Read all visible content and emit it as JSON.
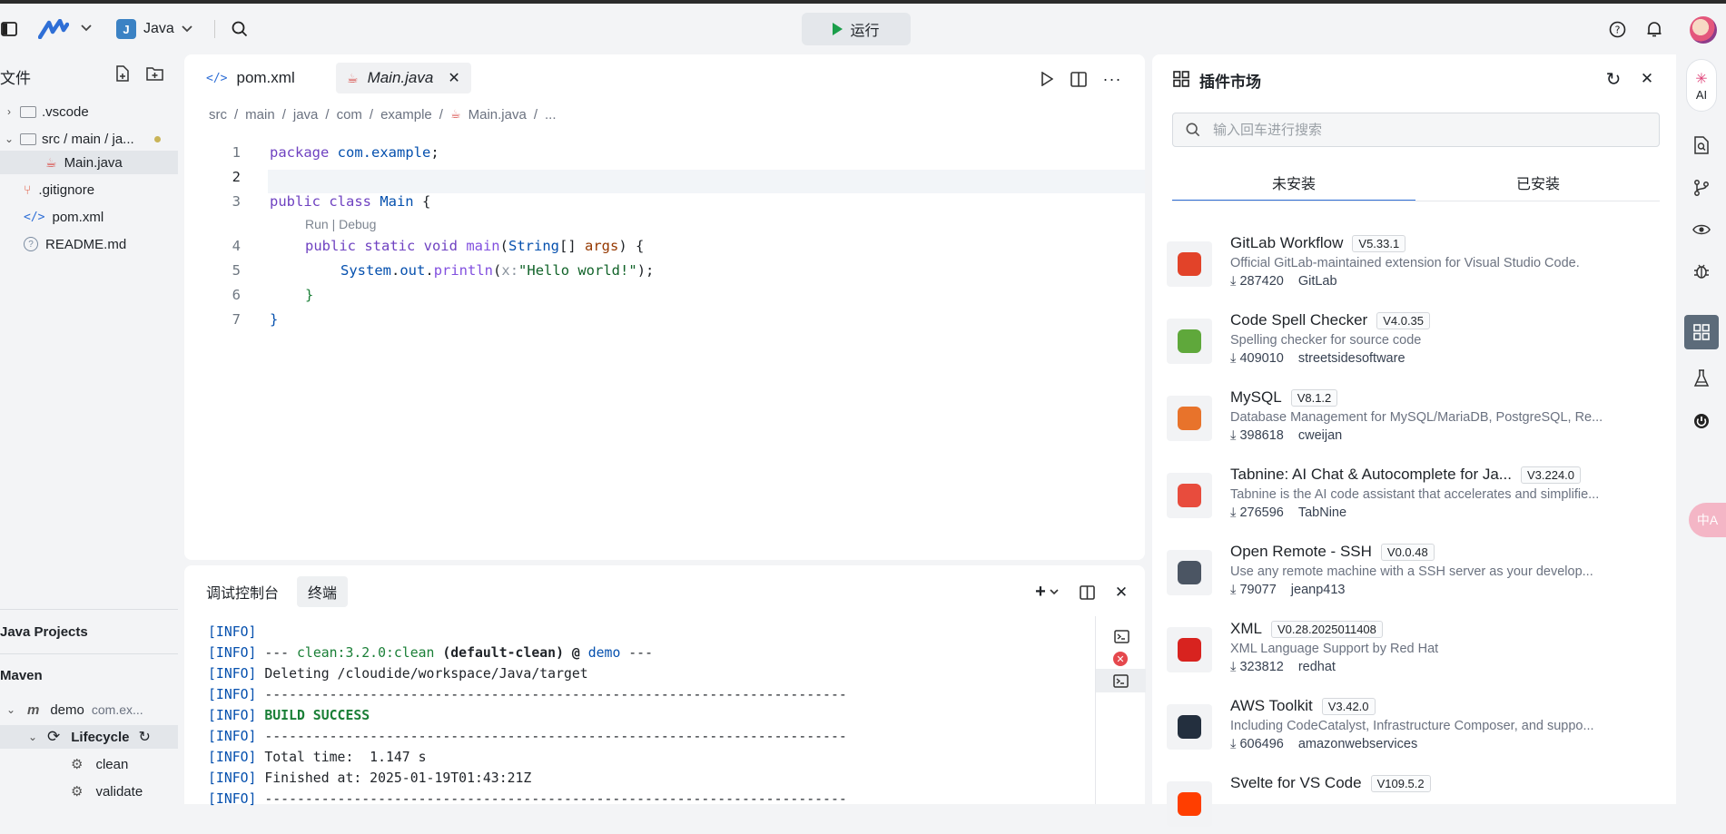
{
  "topbar": {
    "project_name": "Java",
    "run_label": "运行"
  },
  "sidebar": {
    "title": "文件",
    "tree": [
      {
        "label": ".vscode"
      },
      {
        "label": "src / main / ja..."
      },
      {
        "label": "Main.java"
      },
      {
        "label": ".gitignore"
      },
      {
        "label": "pom.xml"
      },
      {
        "label": "README.md"
      }
    ],
    "java_projects": "Java Projects",
    "maven": "Maven",
    "maven_tree": [
      {
        "label": "demo",
        "sub": "com.ex..."
      },
      {
        "label": "Lifecycle"
      },
      {
        "label": "clean"
      },
      {
        "label": "validate"
      }
    ]
  },
  "editor": {
    "tabs": [
      {
        "label": "pom.xml"
      },
      {
        "label": "Main.java"
      }
    ],
    "breadcrumb": [
      "src",
      "main",
      "java",
      "com",
      "example",
      "Main.java",
      "..."
    ],
    "line_numbers": [
      "1",
      "2",
      "3",
      "4",
      "5",
      "6",
      "7"
    ],
    "codelens": "Run | Debug",
    "code": {
      "l1_kw": "package",
      "l1_pkg": " com.example",
      "l1_end": ";",
      "l3_kw": "public class",
      "l3_name": " Main",
      "l3_end": " {",
      "l4_kw": "public static void",
      "l4_fn": " main",
      "l4_p1": "(",
      "l4_type": "String",
      "l4_p2": "[] ",
      "l4_arg": "args",
      "l4_end": ") {",
      "l5_obj": "System",
      "l5_dot1": ".",
      "l5_out": "out",
      "l5_dot2": ".",
      "l5_fn": "println",
      "l5_p1": "(",
      "l5_hint": "x:",
      "l5_str": "\"Hello world!\"",
      "l5_end": ");",
      "l6": "}",
      "l7": "}"
    }
  },
  "terminal": {
    "tabs": [
      {
        "label": "调试控制台"
      },
      {
        "label": "终端"
      }
    ],
    "lines": [
      {
        "tag": "[INFO]",
        "text": ""
      },
      {
        "tag": "[INFO]",
        "pre": " --- ",
        "clean": "clean:3.2.0:clean",
        "mid": " (default-clean) @ ",
        "demo": "demo",
        "post": " ---"
      },
      {
        "tag": "[INFO]",
        "text": " Deleting /cloudide/workspace/Java/target"
      },
      {
        "tag": "[INFO]",
        "text": " ------------------------------------------------------------------------"
      },
      {
        "tag": "[INFO]",
        "success": " BUILD SUCCESS"
      },
      {
        "tag": "[INFO]",
        "text": " ------------------------------------------------------------------------"
      },
      {
        "tag": "[INFO]",
        "text": " Total time:  1.147 s"
      },
      {
        "tag": "[INFO]",
        "text": " Finished at: 2025-01-19T01:43:21Z"
      },
      {
        "tag": "[INFO]",
        "text": " ------------------------------------------------------------------------"
      }
    ]
  },
  "market": {
    "title": "插件市场",
    "search_placeholder": "输入回车进行搜索",
    "tabs": [
      {
        "label": "未安装"
      },
      {
        "label": "已安装"
      }
    ],
    "extensions": [
      {
        "name": "GitLab Workflow",
        "version": "V5.33.1",
        "desc": "Official GitLab-maintained extension for Visual Studio Code.",
        "downloads": "287420",
        "publisher": "GitLab",
        "color": "#e24329"
      },
      {
        "name": "Code Spell Checker",
        "version": "V4.0.35",
        "desc": "Spelling checker for source code",
        "downloads": "409010",
        "publisher": "streetsidesoftware",
        "color": "#5fa83b"
      },
      {
        "name": "MySQL",
        "version": "V8.1.2",
        "desc": "Database Management for MySQL/MariaDB, PostgreSQL, Re...",
        "downloads": "398618",
        "publisher": "cweijan",
        "color": "#e8732b"
      },
      {
        "name": "Tabnine: AI Chat & Autocomplete for Ja...",
        "version": "V3.224.0",
        "desc": "Tabnine is the AI code assistant that accelerates and simplifie...",
        "downloads": "276596",
        "publisher": "TabNine",
        "color": "#e84c3d"
      },
      {
        "name": "Open Remote - SSH",
        "version": "V0.0.48",
        "desc": "Use any remote machine with a SSH server as your develop...",
        "downloads": "79077",
        "publisher": "jeanp413",
        "color": "#4b5563"
      },
      {
        "name": "XML",
        "version": "V0.28.2025011408",
        "desc": "XML Language Support by Red Hat",
        "downloads": "323812",
        "publisher": "redhat",
        "color": "#d8231f"
      },
      {
        "name": "AWS Toolkit",
        "version": "V3.42.0",
        "desc": "Including CodeCatalyst, Infrastructure Composer, and suppo...",
        "downloads": "606496",
        "publisher": "amazonwebservices",
        "color": "#232f3e"
      },
      {
        "name": "Svelte for VS Code",
        "version": "V109.5.2",
        "desc": "",
        "downloads": "",
        "publisher": "",
        "color": "#ff3e00"
      }
    ]
  },
  "rail": {
    "ai_label": "AI",
    "translate_label": "中A"
  },
  "colors": {
    "accent": "#2f6fd6",
    "run_green": "#1a9e4a",
    "success_green": "#1a7f37",
    "info_blue": "#0550ae"
  }
}
